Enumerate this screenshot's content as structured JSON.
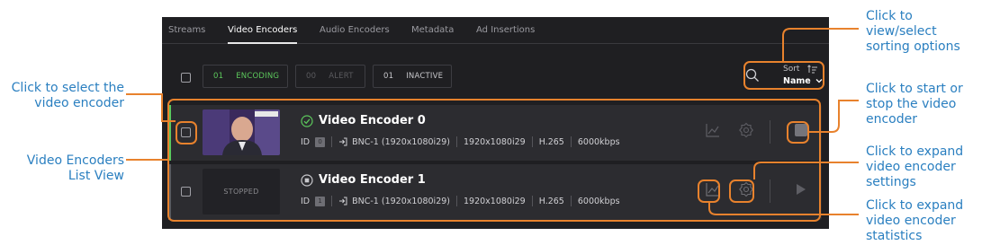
{
  "colors": {
    "callout_text": "#2a7fc0",
    "callout_line": "#e8822d",
    "encoding_green": "#5cc85c",
    "app_background": "#1f1f22",
    "row_background": "#2c2c30"
  },
  "tabs": [
    {
      "label": "Streams"
    },
    {
      "label": "Video Encoders",
      "active": true
    },
    {
      "label": "Audio Encoders"
    },
    {
      "label": "Metadata"
    },
    {
      "label": "Ad Insertions"
    }
  ],
  "filters": {
    "encoding": {
      "count": "01",
      "label": "ENCODING"
    },
    "alert": {
      "count": "00",
      "label": "ALERT"
    },
    "inactive": {
      "count": "01",
      "label": "INACTIVE"
    }
  },
  "sort": {
    "label": "Sort",
    "value": "Name",
    "icons": [
      "search-icon",
      "sort-ascending-icon",
      "chevron-down-icon"
    ]
  },
  "encoders": [
    {
      "name": "Video Encoder 0",
      "status_icon": "check-circle-icon",
      "id_label": "ID",
      "id_value": "0",
      "input": "BNC-1 (1920x1080i29)",
      "resolution": "1920x1080i29",
      "codec": "H.265",
      "bitrate": "6000kbps",
      "thumbnail": "live-preview"
    },
    {
      "name": "Video Encoder 1",
      "status_icon": "stop-circle-icon",
      "id_label": "ID",
      "id_value": "1",
      "input": "BNC-1 (1920x1080i29)",
      "resolution": "1920x1080i29",
      "codec": "H.265",
      "bitrate": "6000kbps",
      "thumbnail": "STOPPED"
    }
  ],
  "callouts": {
    "select_encoder": "Click to select the video encoder",
    "list_view": "Video Encoders List View",
    "sorting": "Click to view/select sorting options",
    "start_stop": "Click to start or stop the video encoder",
    "settings": "Click to expand video encoder settings",
    "statistics": "Click to expand video encoder statistics"
  }
}
